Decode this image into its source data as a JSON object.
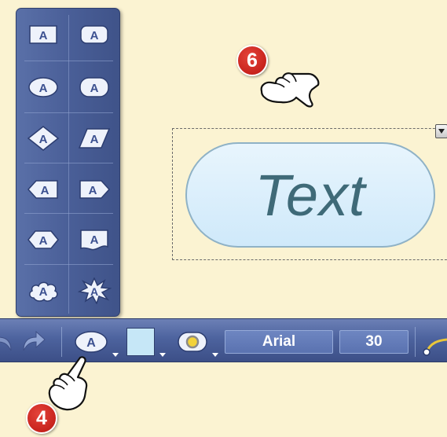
{
  "palette": {
    "shapes": [
      {
        "name": "rectangle",
        "label": "A"
      },
      {
        "name": "rounded-rectangle",
        "label": "A"
      },
      {
        "name": "ellipse",
        "label": "A"
      },
      {
        "name": "rounded-box",
        "label": "A"
      },
      {
        "name": "diamond",
        "label": "A"
      },
      {
        "name": "parallelogram",
        "label": "A"
      },
      {
        "name": "arrow-left",
        "label": "A"
      },
      {
        "name": "arrow-right",
        "label": "A"
      },
      {
        "name": "hexagon",
        "label": "A"
      },
      {
        "name": "wave-box",
        "label": "A"
      },
      {
        "name": "cloud",
        "label": "A"
      },
      {
        "name": "explosion",
        "label": "A"
      }
    ]
  },
  "canvas": {
    "text_box_text": "Text",
    "text_box_fill_color": "#d3ebfa"
  },
  "toolbar": {
    "undo_icon": "undo-arrow-icon",
    "redo_icon": "redo-arrow-icon",
    "shape_button_label": "A",
    "fill_color": "#c6e7f7",
    "border_icon": "border-color-icon",
    "font_name": "Arial",
    "font_size": "30"
  },
  "callouts": {
    "top": "6",
    "bottom": "4"
  },
  "colors": {
    "toolbar": "#4d639e",
    "palette": "#4a5f98",
    "callout": "#c8231d",
    "background": "#fbf3d2"
  }
}
